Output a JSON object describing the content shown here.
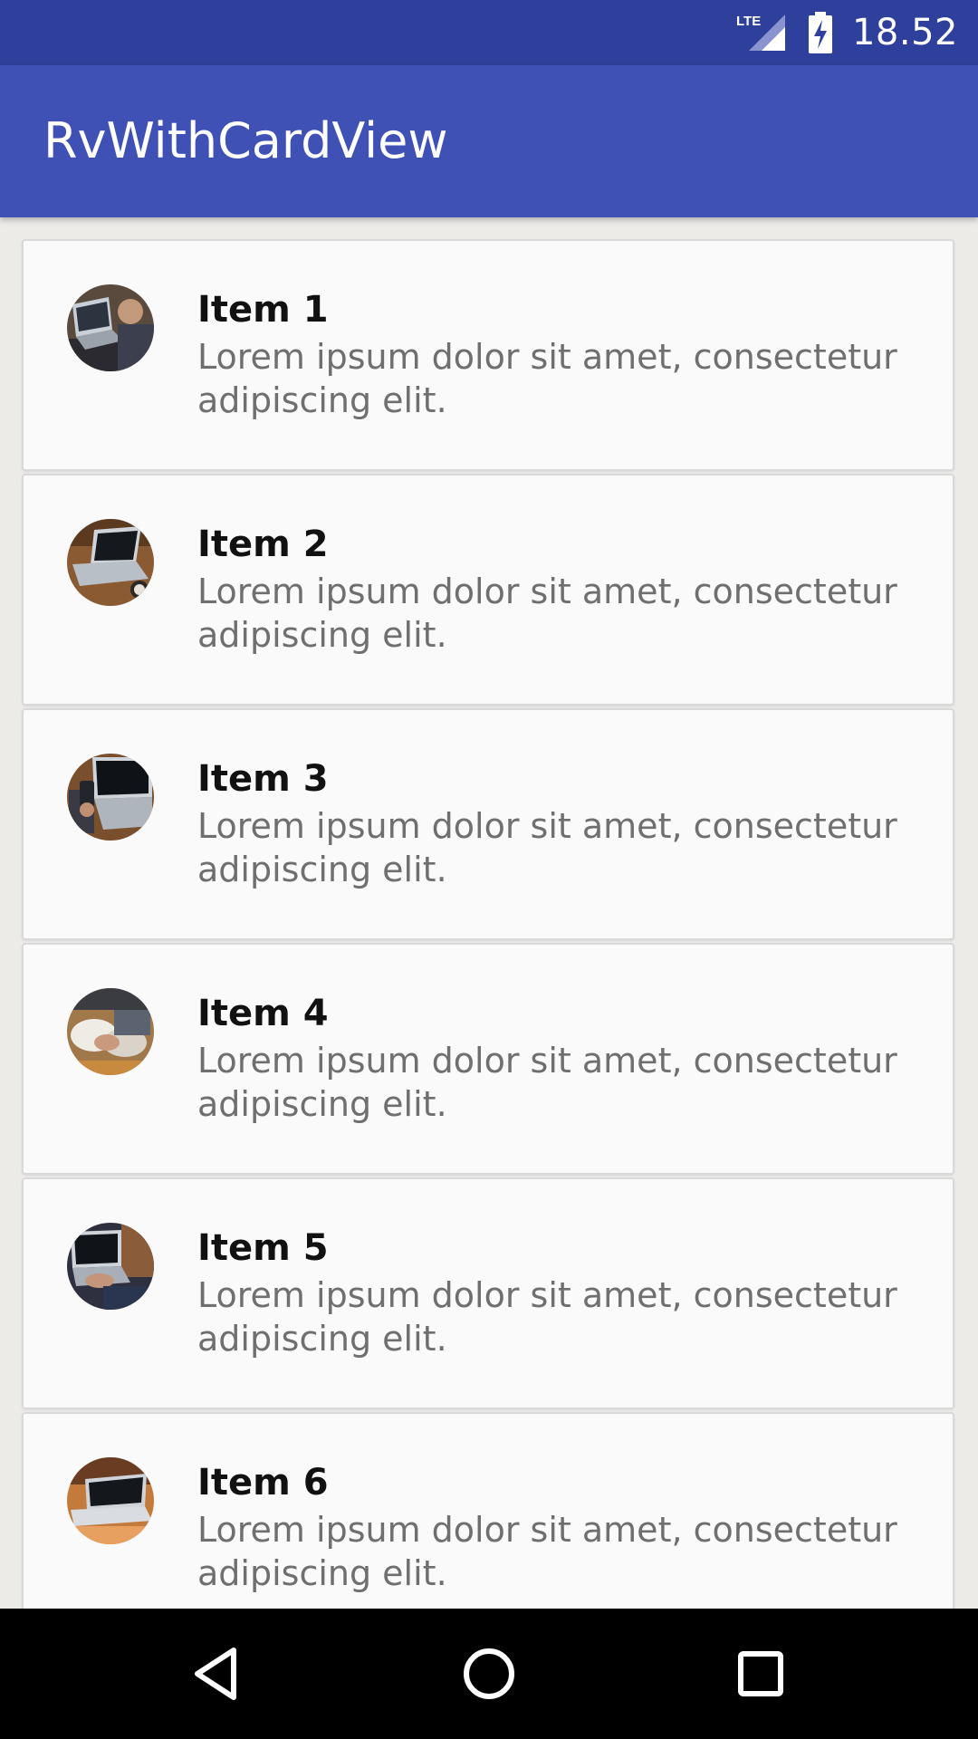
{
  "status_bar": {
    "network_label": "LTE",
    "network_icon": "lte-signal-icon",
    "battery_icon": "battery-charging-icon",
    "time": "18.52"
  },
  "app_bar": {
    "title": "RvWithCardView",
    "color": "#3f51b5",
    "status_color": "#2f409c"
  },
  "list": {
    "items": [
      {
        "title": "Item 1",
        "description": "Lorem ipsum dolor sit amet, consectetur adipiscing elit.",
        "thumbnail_icon": "laptop-photo-icon"
      },
      {
        "title": "Item 2",
        "description": "Lorem ipsum dolor sit amet, consectetur adipiscing elit.",
        "thumbnail_icon": "laptop-photo-icon"
      },
      {
        "title": "Item 3",
        "description": "Lorem ipsum dolor sit amet, consectetur adipiscing elit.",
        "thumbnail_icon": "laptop-photo-icon"
      },
      {
        "title": "Item 4",
        "description": "Lorem ipsum dolor sit amet, consectetur adipiscing elit.",
        "thumbnail_icon": "laptop-photo-icon"
      },
      {
        "title": "Item 5",
        "description": "Lorem ipsum dolor sit amet, consectetur adipiscing elit.",
        "thumbnail_icon": "laptop-photo-icon"
      },
      {
        "title": "Item 6",
        "description": "Lorem ipsum dolor sit amet, consectetur adipiscing elit.",
        "thumbnail_icon": "laptop-photo-icon"
      }
    ]
  },
  "nav_bar": {
    "back_icon": "back-triangle-icon",
    "home_icon": "home-circle-icon",
    "recents_icon": "recents-square-icon"
  }
}
